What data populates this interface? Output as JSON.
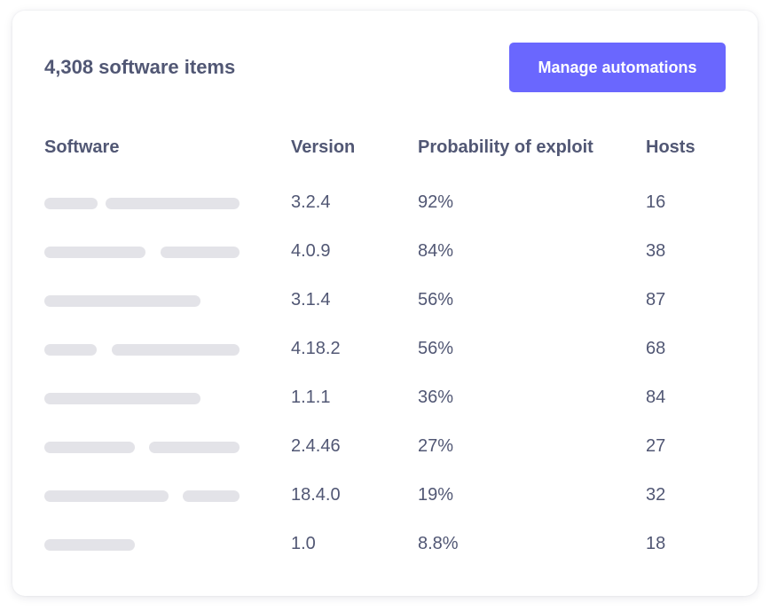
{
  "header": {
    "count_label": "4,308 software items",
    "button_label": "Manage automations"
  },
  "table": {
    "columns": [
      "Software",
      "Version",
      "Probability of exploit",
      "Hosts"
    ],
    "rows": [
      {
        "version": "3.2.4",
        "probability": "92%",
        "hosts": "16"
      },
      {
        "version": "4.0.9",
        "probability": "84%",
        "hosts": "38"
      },
      {
        "version": "3.1.4",
        "probability": "56%",
        "hosts": "87"
      },
      {
        "version": "4.18.2",
        "probability": "56%",
        "hosts": "68"
      },
      {
        "version": "1.1.1",
        "probability": "36%",
        "hosts": "84"
      },
      {
        "version": "2.4.46",
        "probability": "27%",
        "hosts": "27"
      },
      {
        "version": "18.4.0",
        "probability": "19%",
        "hosts": "32"
      },
      {
        "version": "1.0",
        "probability": "8.8%",
        "hosts": "18"
      }
    ]
  },
  "colors": {
    "accent": "#6a67fe",
    "text": "#515774",
    "placeholder": "#e3e3e8"
  }
}
